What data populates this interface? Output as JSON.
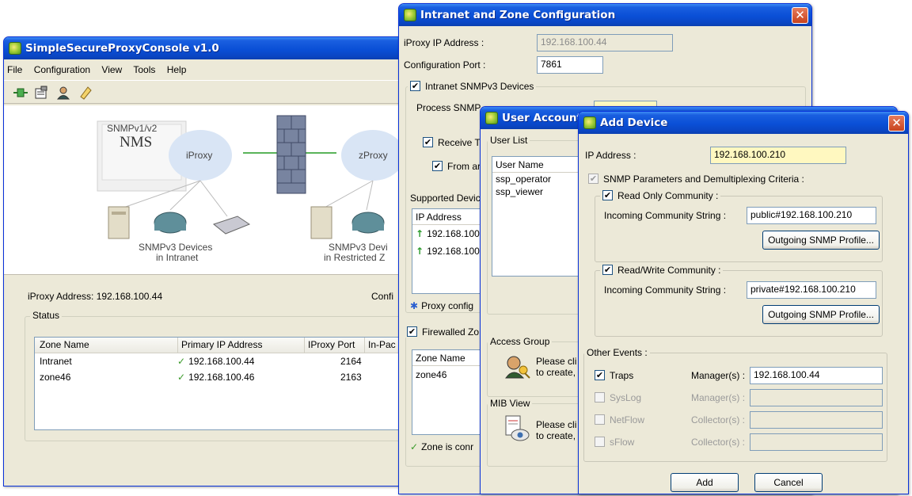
{
  "main_window": {
    "title": "SimpleSecureProxyConsole v1.0",
    "menu": [
      "File",
      "Configuration",
      "View",
      "Tools",
      "Help"
    ],
    "diagram": {
      "nms_label_1": "SNMPv1/v2",
      "nms_label_2": "NMS",
      "iproxy": "iProxy",
      "zproxy": "zProxy",
      "intranet_devices_1": "SNMPv3 Devices",
      "intranet_devices_2": "in Intranet",
      "restricted_devices_1": "SNMPv3 Devi",
      "restricted_devices_2": "in Restricted Z"
    },
    "iproxy_address": "iProxy Address: 192.168.100.44",
    "config_label": "Confi",
    "status_label": "Status",
    "zone_table": {
      "headers": [
        "Zone Name",
        "Primary IP Address",
        "IProxy Port",
        "In-Pac"
      ],
      "rows": [
        {
          "zone": "Intranet",
          "ip": "192.168.100.44",
          "port": "2164"
        },
        {
          "zone": "zone46",
          "ip": "192.168.100.46",
          "port": "2163"
        }
      ]
    }
  },
  "intranet_window": {
    "title": "Intranet and Zone Configuration",
    "iproxy_ip_label": "iProxy IP Address :",
    "iproxy_ip_value": "192.168.100.44",
    "config_port_label": "Configuration Port :",
    "config_port_value": "7861",
    "intranet_snmpv3_label": "Intranet SNMPv3 Devices",
    "process_snmp_label": "Process SNMP",
    "receive_label": "Receive T",
    "from_label": "From ar",
    "supported_label": "Supported Devic",
    "ip_header": "IP Address",
    "ips": [
      "192.168.100",
      "192.168.100"
    ],
    "proxy_config_label": "Proxy config",
    "firewalled_label": "Firewalled Zo",
    "zone_name_header": "Zone Name",
    "zone_row": "zone46",
    "zone_status": "Zone is conr"
  },
  "user_window": {
    "title": "User Account",
    "user_list_label": "User List",
    "user_name_header": "User Name",
    "users": [
      "ssp_operator",
      "ssp_viewer"
    ],
    "access_group_label": "Access Group",
    "access_text_1": "Please cli",
    "access_text_2": "to create,",
    "mib_view_label": "MIB View",
    "mib_text_1": "Please cli",
    "mib_text_2": "to create,"
  },
  "add_device": {
    "title": "Add Device",
    "ip_label": "IP Address :",
    "ip_value": "192.168.100.210",
    "snmp_params_label": "SNMP Parameters and Demultiplexing Criteria :",
    "ro_label": "Read Only Community :",
    "ro_incoming_label": "Incoming Community String :",
    "ro_incoming_value": "public#192.168.100.210",
    "ro_outgoing_btn": "Outgoing SNMP Profile...",
    "rw_label": "Read/Write Community :",
    "rw_incoming_label": "Incoming Community String :",
    "rw_incoming_value": "private#192.168.100.210",
    "rw_outgoing_btn": "Outgoing SNMP Profile...",
    "other_events_label": "Other Events :",
    "events": [
      {
        "name": "Traps",
        "target_label": "Manager(s) :",
        "value": "192.168.100.44"
      },
      {
        "name": "SysLog",
        "target_label": "Manager(s) :",
        "value": ""
      },
      {
        "name": "NetFlow",
        "target_label": "Collector(s) :",
        "value": ""
      },
      {
        "name": "sFlow",
        "target_label": "Collector(s) :",
        "value": ""
      }
    ],
    "add_btn": "Add",
    "cancel_btn": "Cancel"
  }
}
